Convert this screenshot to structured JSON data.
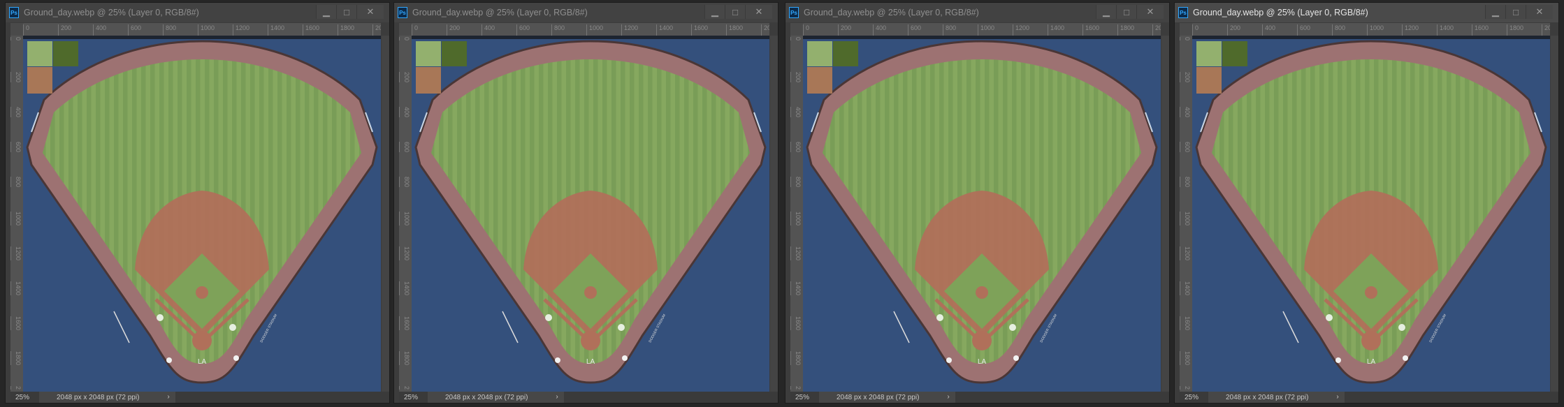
{
  "windows": [
    {
      "title": "Ground_day.webp @ 25% (Layer 0, RGB/8#)",
      "zoom": "25%",
      "doc_info": "2048 px x 2048 px (72 ppi)",
      "active": false
    },
    {
      "title": "Ground_day.webp @ 25% (Layer 0, RGB/8#)",
      "zoom": "25%",
      "doc_info": "2048 px x 2048 px (72 ppi)",
      "active": false
    },
    {
      "title": "Ground_day.webp @ 25% (Layer 0, RGB/8#)",
      "zoom": "25%",
      "doc_info": "2048 px x 2048 px (72 ppi)",
      "active": false
    },
    {
      "title": "Ground_day.webp @ 25% (Layer 0, RGB/8#)",
      "zoom": "25%",
      "doc_info": "2048 px x 2048 px (72 ppi)",
      "active": true
    }
  ],
  "app_icon": "Ps",
  "window_buttons": {
    "minimize": "▁",
    "maximize": "□",
    "close": "✕"
  },
  "status_arrow": "›",
  "ruler_top_labels": [
    "0",
    "200",
    "400",
    "600",
    "800",
    "1000",
    "1200",
    "1400",
    "1600",
    "1800",
    "20"
  ],
  "ruler_left_labels": [
    "0",
    "200",
    "400",
    "600",
    "800",
    "1000",
    "1200",
    "1400",
    "1600",
    "1800",
    "2"
  ],
  "field_logos": {
    "plate_logo": "LA",
    "stadium_text": "DODGER STADIUM"
  },
  "colors": {
    "background": "#34507c",
    "grass_light": "#93b06e",
    "grass_dark": "#4f6a2b",
    "dirt": "#a87757",
    "track": "#9d7272"
  }
}
